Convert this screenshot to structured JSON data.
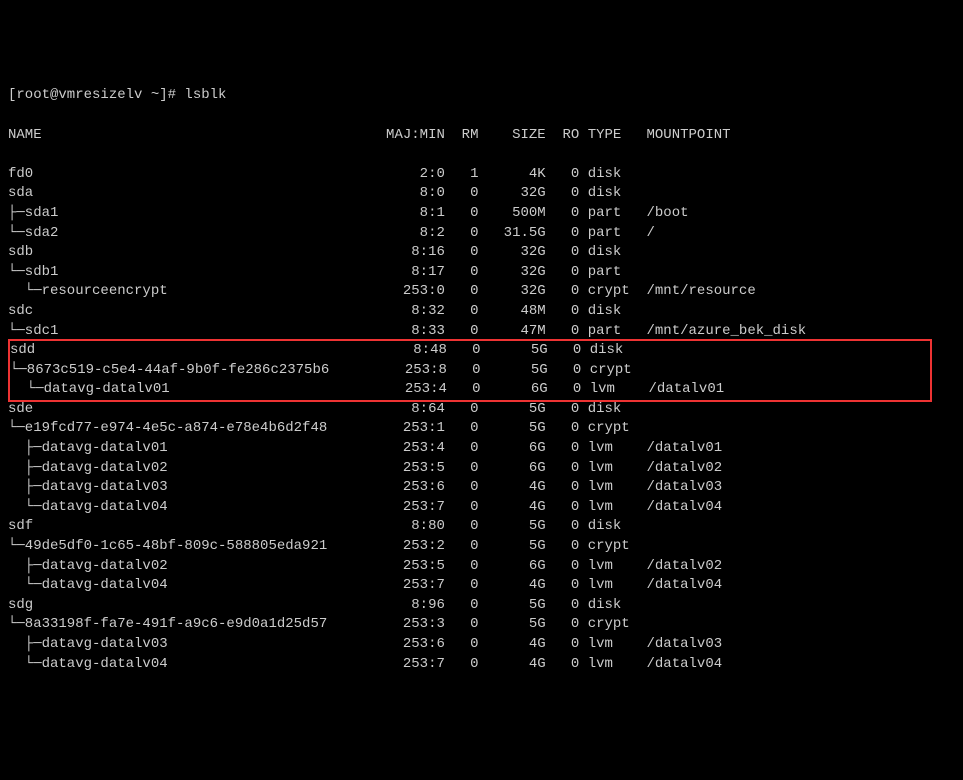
{
  "prompt": "[root@vmresizelv ~]# lsblk",
  "header": {
    "name": "NAME",
    "majmin": "MAJ:MIN",
    "rm": "RM",
    "size": "SIZE",
    "ro": "RO",
    "type": "TYPE",
    "mount": "MOUNTPOINT"
  },
  "rows": [
    {
      "tree": "fd0",
      "majmin": "2:0",
      "rm": "1",
      "size": "4K",
      "ro": "0",
      "type": "disk",
      "mount": "",
      "hl": false
    },
    {
      "tree": "sda",
      "majmin": "8:0",
      "rm": "0",
      "size": "32G",
      "ro": "0",
      "type": "disk",
      "mount": "",
      "hl": false
    },
    {
      "tree": "├─sda1",
      "majmin": "8:1",
      "rm": "0",
      "size": "500M",
      "ro": "0",
      "type": "part",
      "mount": "/boot",
      "hl": false
    },
    {
      "tree": "└─sda2",
      "majmin": "8:2",
      "rm": "0",
      "size": "31.5G",
      "ro": "0",
      "type": "part",
      "mount": "/",
      "hl": false
    },
    {
      "tree": "sdb",
      "majmin": "8:16",
      "rm": "0",
      "size": "32G",
      "ro": "0",
      "type": "disk",
      "mount": "",
      "hl": false
    },
    {
      "tree": "└─sdb1",
      "majmin": "8:17",
      "rm": "0",
      "size": "32G",
      "ro": "0",
      "type": "part",
      "mount": "",
      "hl": false
    },
    {
      "tree": "  └─resourceencrypt",
      "majmin": "253:0",
      "rm": "0",
      "size": "32G",
      "ro": "0",
      "type": "crypt",
      "mount": "/mnt/resource",
      "hl": false
    },
    {
      "tree": "sdc",
      "majmin": "8:32",
      "rm": "0",
      "size": "48M",
      "ro": "0",
      "type": "disk",
      "mount": "",
      "hl": false
    },
    {
      "tree": "└─sdc1",
      "majmin": "8:33",
      "rm": "0",
      "size": "47M",
      "ro": "0",
      "type": "part",
      "mount": "/mnt/azure_bek_disk",
      "hl": false
    },
    {
      "tree": "sdd",
      "majmin": "8:48",
      "rm": "0",
      "size": "5G",
      "ro": "0",
      "type": "disk",
      "mount": "",
      "hl": true
    },
    {
      "tree": "└─8673c519-c5e4-44af-9b0f-fe286c2375b6",
      "majmin": "253:8",
      "rm": "0",
      "size": "5G",
      "ro": "0",
      "type": "crypt",
      "mount": "",
      "hl": true
    },
    {
      "tree": "  └─datavg-datalv01",
      "majmin": "253:4",
      "rm": "0",
      "size": "6G",
      "ro": "0",
      "type": "lvm",
      "mount": "/datalv01",
      "hl": true
    },
    {
      "tree": "sde",
      "majmin": "8:64",
      "rm": "0",
      "size": "5G",
      "ro": "0",
      "type": "disk",
      "mount": "",
      "hl": false
    },
    {
      "tree": "└─e19fcd77-e974-4e5c-a874-e78e4b6d2f48",
      "majmin": "253:1",
      "rm": "0",
      "size": "5G",
      "ro": "0",
      "type": "crypt",
      "mount": "",
      "hl": false
    },
    {
      "tree": "  ├─datavg-datalv01",
      "majmin": "253:4",
      "rm": "0",
      "size": "6G",
      "ro": "0",
      "type": "lvm",
      "mount": "/datalv01",
      "hl": false
    },
    {
      "tree": "  ├─datavg-datalv02",
      "majmin": "253:5",
      "rm": "0",
      "size": "6G",
      "ro": "0",
      "type": "lvm",
      "mount": "/datalv02",
      "hl": false
    },
    {
      "tree": "  ├─datavg-datalv03",
      "majmin": "253:6",
      "rm": "0",
      "size": "4G",
      "ro": "0",
      "type": "lvm",
      "mount": "/datalv03",
      "hl": false
    },
    {
      "tree": "  └─datavg-datalv04",
      "majmin": "253:7",
      "rm": "0",
      "size": "4G",
      "ro": "0",
      "type": "lvm",
      "mount": "/datalv04",
      "hl": false
    },
    {
      "tree": "sdf",
      "majmin": "8:80",
      "rm": "0",
      "size": "5G",
      "ro": "0",
      "type": "disk",
      "mount": "",
      "hl": false
    },
    {
      "tree": "└─49de5df0-1c65-48bf-809c-588805eda921",
      "majmin": "253:2",
      "rm": "0",
      "size": "5G",
      "ro": "0",
      "type": "crypt",
      "mount": "",
      "hl": false
    },
    {
      "tree": "  ├─datavg-datalv02",
      "majmin": "253:5",
      "rm": "0",
      "size": "6G",
      "ro": "0",
      "type": "lvm",
      "mount": "/datalv02",
      "hl": false
    },
    {
      "tree": "  └─datavg-datalv04",
      "majmin": "253:7",
      "rm": "0",
      "size": "4G",
      "ro": "0",
      "type": "lvm",
      "mount": "/datalv04",
      "hl": false
    },
    {
      "tree": "sdg",
      "majmin": "8:96",
      "rm": "0",
      "size": "5G",
      "ro": "0",
      "type": "disk",
      "mount": "",
      "hl": false
    },
    {
      "tree": "└─8a33198f-fa7e-491f-a9c6-e9d0a1d25d57",
      "majmin": "253:3",
      "rm": "0",
      "size": "5G",
      "ro": "0",
      "type": "crypt",
      "mount": "",
      "hl": false
    },
    {
      "tree": "  ├─datavg-datalv03",
      "majmin": "253:6",
      "rm": "0",
      "size": "4G",
      "ro": "0",
      "type": "lvm",
      "mount": "/datalv03",
      "hl": false
    },
    {
      "tree": "  └─datavg-datalv04",
      "majmin": "253:7",
      "rm": "0",
      "size": "4G",
      "ro": "0",
      "type": "lvm",
      "mount": "/datalv04",
      "hl": false
    }
  ]
}
